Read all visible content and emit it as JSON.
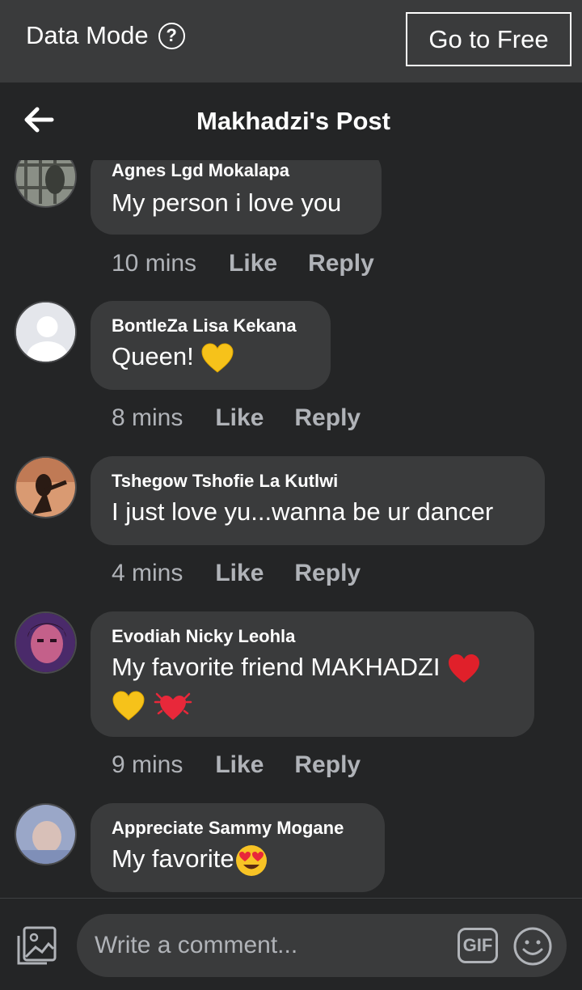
{
  "banner": {
    "title": "Data Mode",
    "help_icon": "?",
    "go_free_label": "Go to Free"
  },
  "header": {
    "title": "Makhadzi's Post",
    "back_icon": "back-arrow-icon"
  },
  "comments": [
    {
      "author": "Agnes Lgd Mokalapa",
      "text": "My person i love you",
      "time": "10 mins",
      "like": "Like",
      "reply": "Reply",
      "emojis": []
    },
    {
      "author": "BontleZa Lisa Kekana",
      "text": "Queen! ",
      "time": "8 mins",
      "like": "Like",
      "reply": "Reply",
      "emojis": [
        "yellow-heart"
      ]
    },
    {
      "author": "Tshegow Tshofie La Kutlwi",
      "text": "I just love yu...wanna be ur dancer",
      "time": "4 mins",
      "like": "Like",
      "reply": "Reply",
      "emojis": []
    },
    {
      "author": "Evodiah Nicky Leohla",
      "text": "My favorite friend MAKHADZI ",
      "time": "9 mins",
      "like": "Like",
      "reply": "Reply",
      "emojis": [
        "red-heart",
        "yellow-heart",
        "beating-heart"
      ]
    },
    {
      "author": "Appreciate Sammy Mogane",
      "text": "My favorite",
      "time": "",
      "like": "",
      "reply": "",
      "emojis": [
        "heart-eyes"
      ]
    }
  ],
  "composer": {
    "placeholder": "Write a comment...",
    "gif_label": "GIF",
    "photo_icon": "photo-icon",
    "emoji_icon": "smile-icon"
  },
  "colors": {
    "background": "#242526",
    "bubble": "#3a3b3c",
    "banner": "#3a3b3c",
    "secondary_text": "#b0b3b8"
  }
}
